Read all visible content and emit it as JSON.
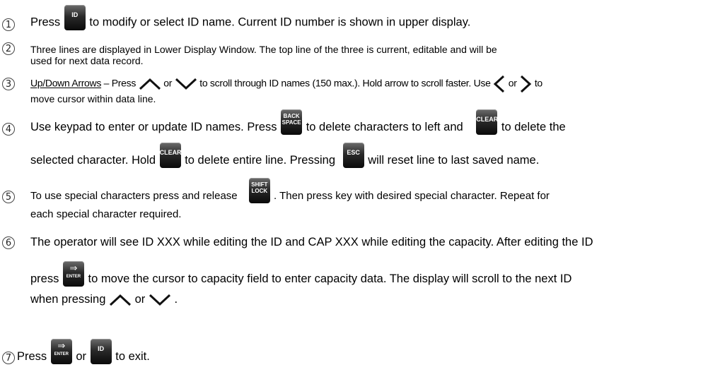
{
  "steps": [
    {
      "num": "1",
      "parts": {
        "a": "Press",
        "key_id": "ID",
        "b": "to modify or select ID name. Current ID number is shown in upper display."
      }
    },
    {
      "num": "2",
      "line1": "Three lines are displayed in Lower Display Window. The top line of the three is current, editable and will be",
      "line2": "used for next data record."
    },
    {
      "num": "3",
      "link": "Up/Down Arrows",
      "a": "– Press",
      "or1": "or",
      "b": "to scroll through ID names (150 max.). Hold arrow to scroll faster. Use",
      "or2": "or",
      "c": "to",
      "line2": "move cursor within data line."
    },
    {
      "num": "4",
      "a": "Use keypad to enter or update ID names. Press",
      "key_back_1": "BACK",
      "key_back_2": "SPACE",
      "b": "to delete characters to left and",
      "key_clear": "CLEAR",
      "c": "to delete the",
      "d": "selected character. Hold",
      "key_clear2": "CLEAR",
      "e": "to delete entire line. Pressing",
      "key_esc": "ESC",
      "f": "will reset line to last saved name."
    },
    {
      "num": "5",
      "a": "To use special characters press and release",
      "key_shift_1": "SHIFT",
      "key_shift_2": "LOCK",
      "b": ". Then press key with desired special character. Repeat for",
      "line2": "each special character required."
    },
    {
      "num": "6",
      "line1": "The operator will see ID XXX while editing the ID and CAP XXX while editing the capacity. After editing the ID",
      "a": "press",
      "key_enter": "ENTER",
      "b": "to move the cursor to capacity field to enter capacity data. The display will scroll to the next ID",
      "c": "when pressing",
      "or": "or",
      "d": "."
    },
    {
      "num": "7",
      "a": "Press",
      "key_enter": "ENTER",
      "or": "or",
      "key_id": "ID",
      "b": "to exit."
    }
  ]
}
